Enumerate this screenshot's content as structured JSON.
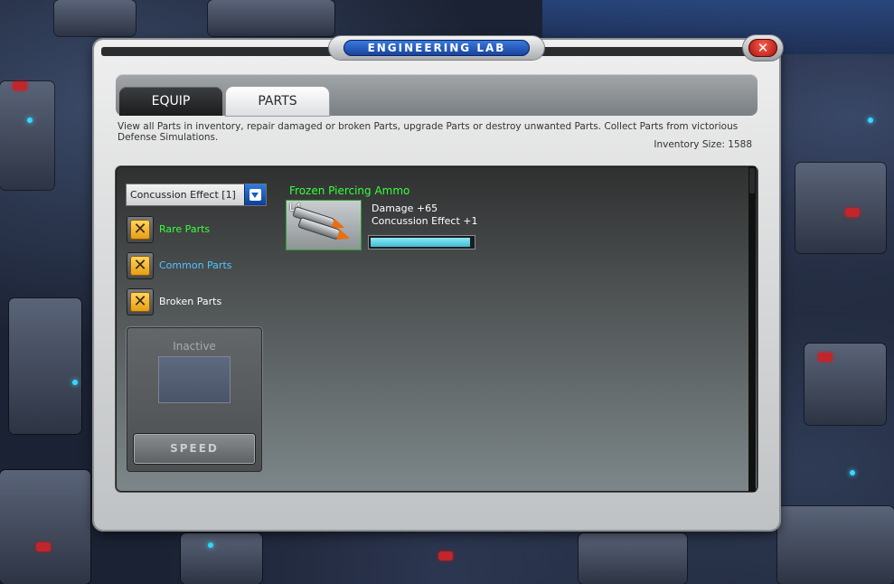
{
  "window": {
    "title": "ENGINEERING LAB",
    "close_label": "✕"
  },
  "tabs": [
    {
      "label": "EQUIP",
      "active": false
    },
    {
      "label": "PARTS",
      "active": true
    }
  ],
  "description": "View all Parts in inventory, repair damaged or broken Parts, upgrade Parts or destroy unwanted Parts. Collect Parts from victorious Defense Simulations.",
  "inventory_size": "Inventory Size: 1588",
  "filter": {
    "dropdown_value": "Concussion Effect [1]",
    "options": [
      {
        "label": "Rare Parts",
        "checked": true,
        "color": "#38ff3a"
      },
      {
        "label": "Common Parts",
        "checked": true,
        "color": "#4fc6ff"
      },
      {
        "label": "Broken Parts",
        "checked": true,
        "color": "#ffffff"
      }
    ],
    "check_glyph": "✕"
  },
  "speed_panel": {
    "status": "Inactive",
    "button_label": "SPEED"
  },
  "part": {
    "name": "Frozen Piercing Ammo",
    "level": "L4",
    "stats": [
      "Damage +65",
      "Concussion Effect +1"
    ],
    "health_fraction": 0.97
  },
  "colors": {
    "accent_blue": "#1a5bc0",
    "rare_green": "#38ff3a",
    "common_blue": "#4fc6ff"
  }
}
